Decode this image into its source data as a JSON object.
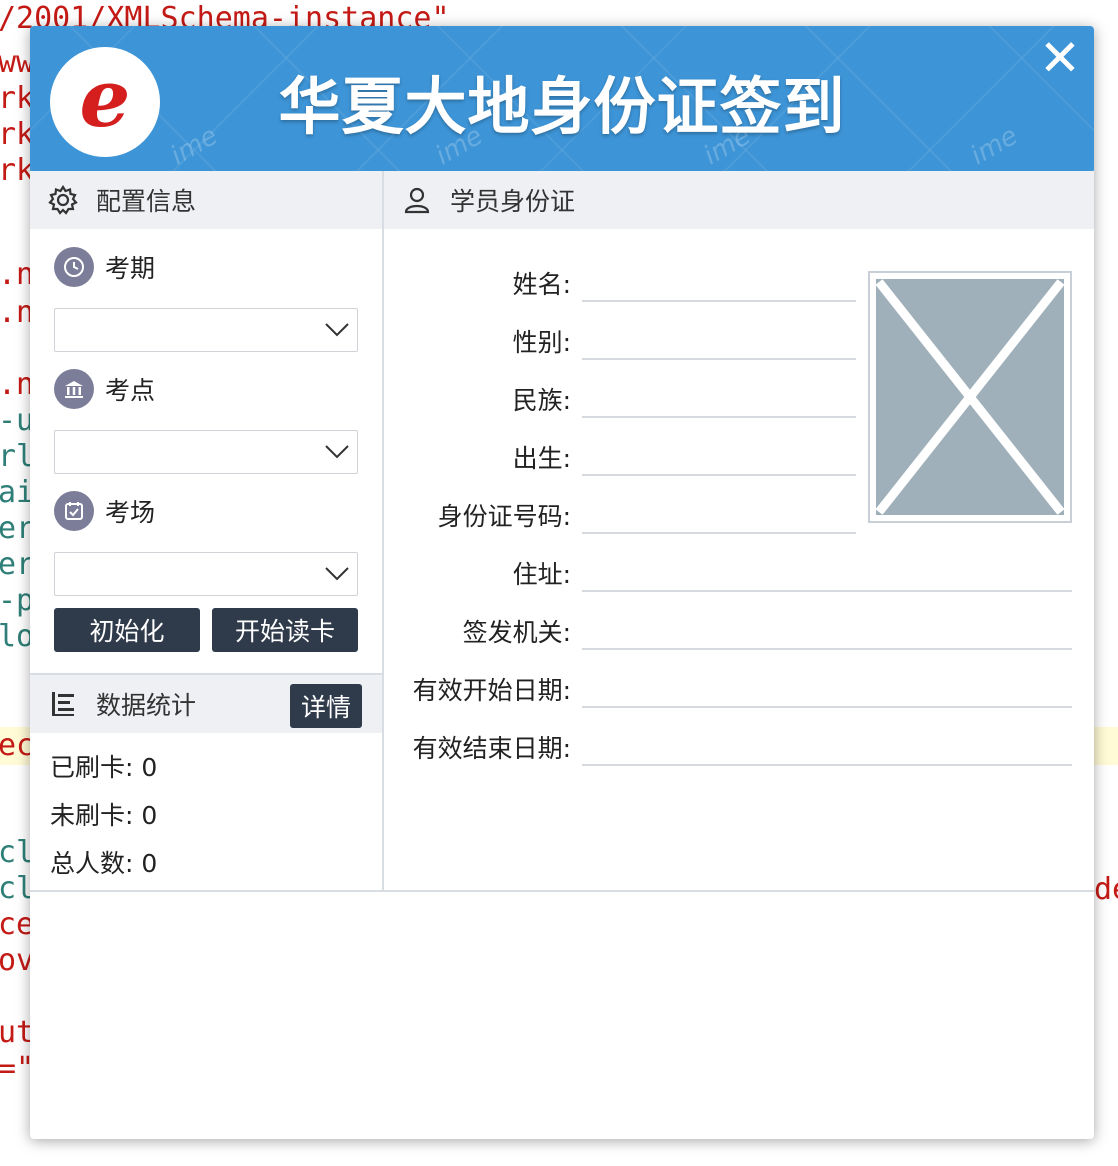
{
  "background_code": {
    "lines": [
      {
        "text": "/2001/XMLSchema-instance\"",
        "color": "#c41a16"
      },
      {
        "text": "ww.",
        "color": "#c41a16"
      },
      {
        "text": "rk.",
        "color": "#c41a16"
      },
      {
        "text": "rk.",
        "color": "#c41a16"
      },
      {
        "text": "rk.",
        "color": "#c41a16"
      },
      {
        "text": ".n'",
        "color": "#c41a16"
      },
      {
        "text": ".n'",
        "color": "#c41a16"
      },
      {
        "text": ".n'",
        "color": "#c41a16"
      },
      {
        "text": "-ur",
        "color": "#2f7f78"
      },
      {
        "text": "rl",
        "color": "#2f7f78"
      },
      {
        "text": "ail",
        "color": "#2f7f78"
      },
      {
        "text": "er=",
        "color": "#2f7f78"
      },
      {
        "text": "er=",
        "color": "#2f7f78"
      },
      {
        "text": "-po",
        "color": "#2f7f78"
      },
      {
        "text": " lo",
        "color": "#2f7f78"
      },
      {
        "text": "ecr",
        "color": "#c41a16"
      },
      {
        "text": "clo",
        "color": "#2f7f78"
      },
      {
        "text": " cl",
        "color": "#2f7f78"
      },
      {
        "text": "ce'",
        "color": "#c41a16"
      },
      {
        "text": "ovi",
        "color": "#c41a16"
      },
      {
        "text": "uth",
        "color": "#c41a16"
      },
      {
        "text": "=\"c",
        "color": "#c41a16"
      }
    ],
    "right_fragment": "de"
  },
  "dialog": {
    "title": "华夏大地身份证签到",
    "logo_letter": "e",
    "watermark": "ime",
    "close_label": "✕"
  },
  "config": {
    "header": "配置信息",
    "exam_period_label": "考期",
    "exam_site_label": "考点",
    "exam_room_label": "考场",
    "exam_period_value": "",
    "exam_site_value": "",
    "exam_room_value": "",
    "init_button": "初始化",
    "read_button": "开始读卡"
  },
  "stats": {
    "header": "数据统计",
    "detail_button": "详情",
    "swiped": "已刷卡: 0",
    "unswiped": "未刷卡: 0",
    "total": "总人数: 0"
  },
  "id_card": {
    "header": "学员身份证",
    "fields": {
      "name": "姓名:",
      "gender": "性别:",
      "ethnicity": "民族:",
      "birth": "出生:",
      "id_number": "身份证号码:",
      "address": "住址:",
      "issuer": "签发机关:",
      "valid_from": "有效开始日期:",
      "valid_to": "有效结束日期:"
    }
  },
  "colors": {
    "header_blue": "#3d94d6",
    "button_dark": "#2f3b4b",
    "section_bg": "#eef0f4",
    "photo_placeholder": "#a0b0ba",
    "icon_purple": "#7b7d99"
  }
}
